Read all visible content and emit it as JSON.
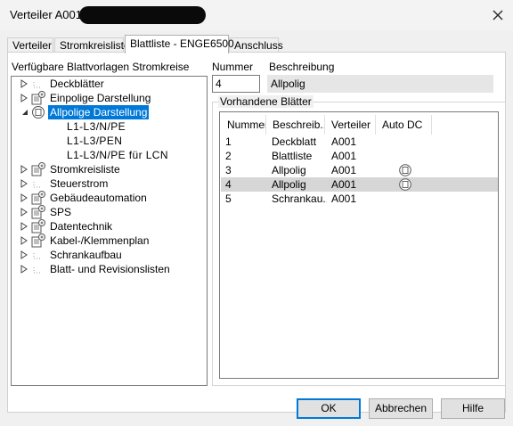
{
  "window": {
    "title": "Verteiler A001,"
  },
  "tabs": [
    {
      "label": "Verteiler"
    },
    {
      "label": "Stromkreisliste"
    },
    {
      "label": "Blattliste - ENGE6500"
    },
    {
      "label": "Anschluss"
    }
  ],
  "tree": {
    "heading": "Verfügbare Blattvorlagen Stromkreise",
    "items": [
      {
        "label": "Deckblätter",
        "icon": "dots-icon"
      },
      {
        "label": "Einpolige Darstellung",
        "icon": "sheet-stack-icon"
      },
      {
        "label": "Allpolige Darstellung",
        "icon": "sheet-template-icon",
        "selected": true,
        "expanded": true,
        "children": [
          {
            "label": "L1-L3/N/PE"
          },
          {
            "label": "L1-L3/PEN"
          },
          {
            "label": "L1-L3/N/PE für LCN"
          }
        ]
      },
      {
        "label": "Stromkreisliste",
        "icon": "sheet-stack-icon"
      },
      {
        "label": "Steuerstrom",
        "icon": "dots-icon"
      },
      {
        "label": "Gebäudeautomation",
        "icon": "sheet-stack-icon"
      },
      {
        "label": "SPS",
        "icon": "sheet-stack-icon"
      },
      {
        "label": "Datentechnik",
        "icon": "sheet-stack-icon"
      },
      {
        "label": "Kabel-/Klemmenplan",
        "icon": "sheet-stack-icon"
      },
      {
        "label": "Schrankaufbau",
        "icon": "dots-icon"
      },
      {
        "label": "Blatt- und Revisionslisten",
        "icon": "dots-icon"
      }
    ]
  },
  "form": {
    "nummer_label": "Nummer",
    "nummer_value": "4",
    "beschreibung_label": "Beschreibung",
    "beschreibung_value": "Allpolig"
  },
  "sheets": {
    "group_label": "Vorhandene Blätter",
    "columns": [
      "Nummer",
      "Beschreib...",
      "Verteiler",
      "Auto DC"
    ],
    "rows": [
      {
        "nummer": "1",
        "beschreibung": "Deckblatt",
        "verteiler": "A001",
        "auto_dc": false
      },
      {
        "nummer": "2",
        "beschreibung": "Blattliste",
        "verteiler": "A001",
        "auto_dc": false
      },
      {
        "nummer": "3",
        "beschreibung": "Allpolig",
        "verteiler": "A001",
        "auto_dc": true
      },
      {
        "nummer": "4",
        "beschreibung": "Allpolig",
        "verteiler": "A001",
        "auto_dc": true,
        "selected": true
      },
      {
        "nummer": "5",
        "beschreibung": "Schrankau...",
        "verteiler": "A001",
        "auto_dc": false
      }
    ]
  },
  "buttons": {
    "ok": "OK",
    "cancel": "Abbrechen",
    "help": "Hilfe"
  },
  "colors": {
    "selection": "#0078d7",
    "row_selection": "#d6d6d6",
    "dialog_bg": "#f0f0f0"
  }
}
